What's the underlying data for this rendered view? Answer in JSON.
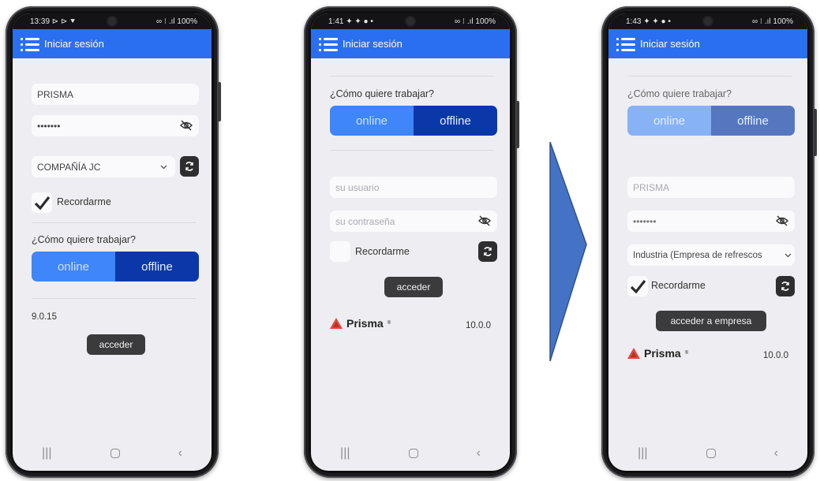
{
  "phone1": {
    "status": {
      "time": "13:39 ⊳ ⊳ ⯆",
      "right": "∞ ⁝ .ıl 100%"
    },
    "appbar": {
      "title": "Iniciar sesión"
    },
    "user_value": "PRISMA",
    "password_value": "•••••••",
    "company_selected": "COMPAÑÍA JC",
    "remember_label": "Recordarme",
    "mode_question": "¿Cómo quiere trabajar?",
    "mode_online": "online",
    "mode_offline": "offline",
    "version": "9.0.15",
    "login_button": "acceder"
  },
  "phone2": {
    "status": {
      "time": "1:41 ✦ ✦ ● •",
      "right": "∞ ⁝ .ıl 100%"
    },
    "appbar": {
      "title": "Iniciar sesión"
    },
    "mode_question": "¿Cómo quiere trabajar?",
    "mode_online": "online",
    "mode_offline": "offline",
    "user_placeholder": "su usuario",
    "password_placeholder": "su contraseña",
    "remember_label": "Recordarme",
    "login_button": "acceder",
    "brand": "Prisma",
    "brand_mark": "®",
    "version": "10.0.0"
  },
  "phone3": {
    "status": {
      "time": "1:43 ✦ ✦ ● •",
      "right": "∞ ⁝ .ıl 100%"
    },
    "appbar": {
      "title": "Iniciar sesión"
    },
    "mode_question": "¿Cómo quiere trabajar?",
    "mode_online": "online",
    "mode_offline": "offline",
    "user_value": "PRISMA",
    "password_value": "•••••••",
    "company_selected": "Industria (Empresa de refrescos",
    "remember_label": "Recordarme",
    "login_button": "acceder a empresa",
    "brand": "Prisma",
    "brand_mark": "®",
    "version": "10.0.0"
  },
  "nav": {
    "recents": "|||",
    "back": "‹"
  },
  "colors": {
    "appbar": "#2a6ff0",
    "online": "#3e86fa",
    "offline": "#0b38a8",
    "arrow": "#4472c4",
    "brand": "#e0483b"
  }
}
